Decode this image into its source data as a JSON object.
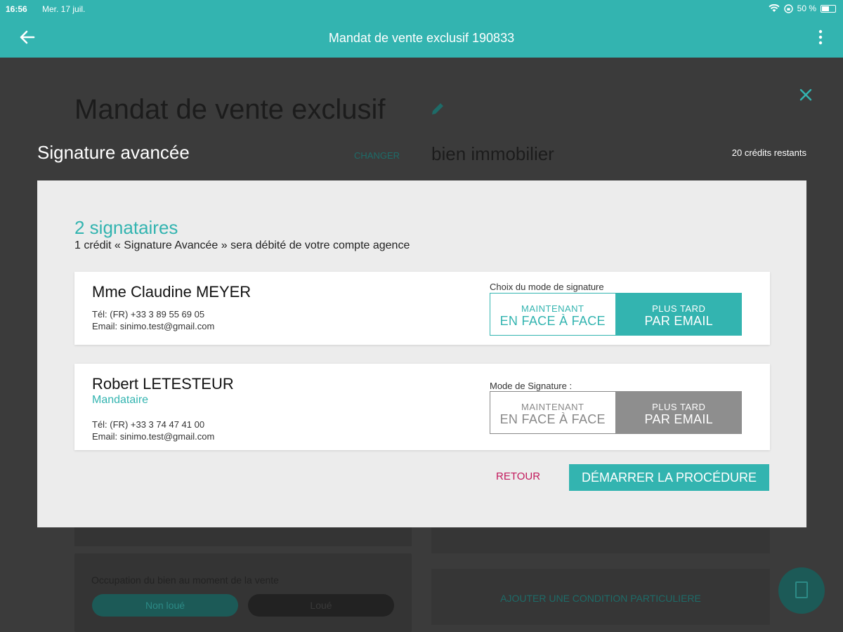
{
  "status_bar": {
    "time": "16:56",
    "date": "Mer. 17 juil.",
    "battery": "50 %"
  },
  "app_bar": {
    "title": "Mandat de vente exclusif 190833"
  },
  "background": {
    "page_title": "Mandat de vente exclusif",
    "changer_label": "CHANGER",
    "section_title": "bien immobilier",
    "occupation_label": "Occupation du bien au moment de la vente",
    "occupation_options": [
      "Non loué",
      "Loué"
    ],
    "add_condition_label": "AJOUTER UNE CONDITION PARTICULIERE"
  },
  "dialog": {
    "heading": "Signature avancée",
    "credits": "20 crédits restants",
    "signer_count": "2 signataires",
    "debit_note": "1 crédit « Signature Avancée » sera débité de votre compte agence",
    "signers": [
      {
        "name": "Mme Claudine MEYER",
        "role": "",
        "phone": "Tél: (FR) +33 3 89 55 69 05",
        "email": "Email: sinimo.test@gmail.com",
        "mode_label": "Choix du mode de signature",
        "option_a_small": "MAINTENANT",
        "option_a_big": "EN FACE À FACE",
        "option_b_small": "PLUS TARD",
        "option_b_big": "PAR EMAIL",
        "selected": "PAR EMAIL"
      },
      {
        "name": "Robert LETESTEUR",
        "role": "Mandataire",
        "phone": "Tél: (FR) +33 3 74 47 41 00",
        "email": "Email: sinimo.test@gmail.com",
        "mode_label": "Mode de Signature :",
        "option_a_small": "MAINTENANT",
        "option_a_big": "EN FACE À FACE",
        "option_b_small": "PLUS TARD",
        "option_b_big": "PAR EMAIL",
        "selected": "PAR EMAIL"
      }
    ],
    "back_label": "RETOUR",
    "start_label": "DÉMARRER LA PROCÉDURE"
  },
  "colors": {
    "accent": "#33b4b0",
    "back_link": "#c2185b",
    "disabled_gray": "#8e8e8e"
  }
}
